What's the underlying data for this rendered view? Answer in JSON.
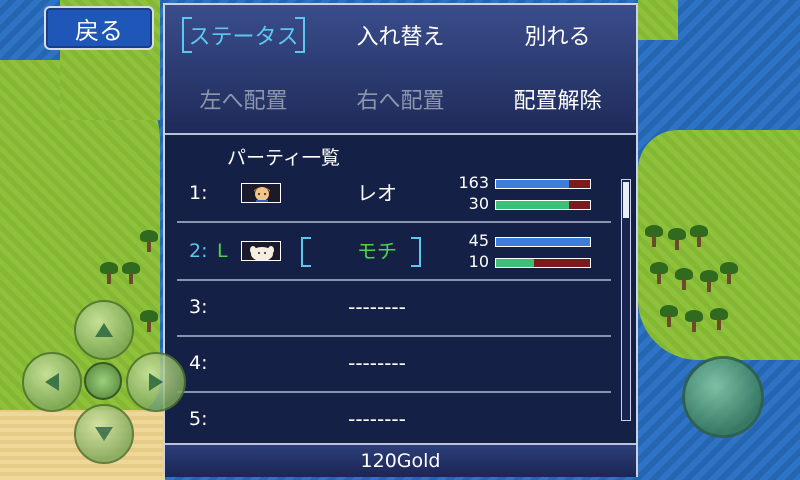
{
  "back_button": {
    "label": "戻る"
  },
  "tabs": [
    {
      "label": "ステータス",
      "state": "selected"
    },
    {
      "label": "入れ替え",
      "state": "normal"
    },
    {
      "label": "別れる",
      "state": "normal"
    }
  ],
  "actions": [
    {
      "label": "左へ配置",
      "state": "disabled"
    },
    {
      "label": "右へ配置",
      "state": "disabled"
    },
    {
      "label": "配置解除",
      "state": "normal"
    }
  ],
  "party": {
    "title": "パーティ一覧",
    "members": [
      {
        "slot": "1:",
        "leader": "",
        "name": "レオ",
        "hp": "163",
        "mp": "30",
        "hp_ratio": 0.78,
        "mp_ratio": 0.78,
        "portrait": "hero-portrait"
      },
      {
        "slot": "2:",
        "leader": "L",
        "name": "モチ",
        "hp": "45",
        "mp": "10",
        "hp_ratio": 1.0,
        "mp_ratio": 0.4,
        "portrait": "white-creature-portrait"
      },
      {
        "slot": "3:",
        "leader": "",
        "name": "--------"
      },
      {
        "slot": "4:",
        "leader": "",
        "name": "--------"
      },
      {
        "slot": "5:",
        "leader": "",
        "name": "--------"
      }
    ]
  },
  "gold": {
    "label": "120Gold"
  },
  "colors": {
    "accent": "#5cc8f0",
    "leader": "#4bd34b",
    "hp_bar": "#3c7ed8",
    "mp_bar": "#3dbf78",
    "bar_empty": "#7a1c1c"
  }
}
